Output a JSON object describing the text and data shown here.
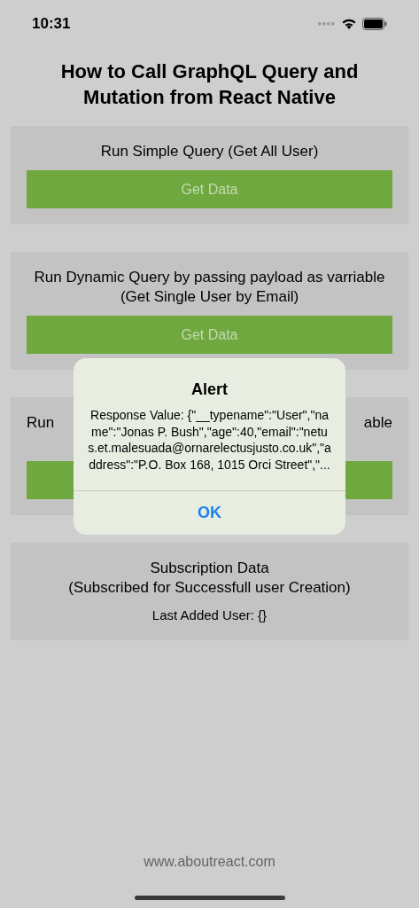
{
  "status_bar": {
    "time": "10:31"
  },
  "title": "How to Call GraphQL Query and Mutation from React Native",
  "cards": [
    {
      "kind": "query",
      "title": "Run Simple Query (Get All User)",
      "button": "Get Data"
    },
    {
      "kind": "query",
      "title": "Run Dynamic Query by passing payload as varriable\n(Get Single User by Email)",
      "button": "Get Data"
    },
    {
      "kind": "partial",
      "title_start": "Run",
      "title_end": "able"
    },
    {
      "kind": "subscription",
      "title": "Subscription Data\n(Subscribed for Successfull user Creation)",
      "value": "Last Added User: {}"
    }
  ],
  "footer": "www.aboutreact.com",
  "alert": {
    "title": "Alert",
    "message": "Response Value: {\"__typename\":\"User\",\"name\":\"Jonas P. Bush\",\"age\":40,\"email\":\"netus.et.malesuada@ornarelectusjusto.co.uk\",\"address\":\"P.O. Box 168, 1015 Orci Street\",\"...",
    "button": "OK"
  }
}
